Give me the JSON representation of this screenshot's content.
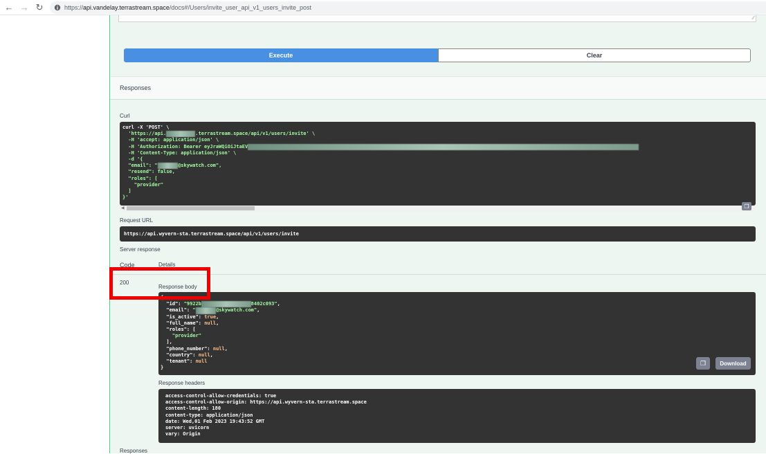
{
  "browser": {
    "url_prefix": "https://",
    "url_host": "api.vandelay.terrastream.space",
    "url_path": "/docs#/Users/invite_user_api_v1_users_invite_post"
  },
  "buttons": {
    "execute": "Execute",
    "clear": "Clear"
  },
  "responses_title": "Responses",
  "curl": {
    "label": "Curl",
    "lines": [
      "curl -X 'POST' \\",
      "  'https://api.",
      ".terrastream.space/api/v1/users/invite' \\",
      "  -H 'accept: application/json' \\",
      "  -H 'Authorization: Bearer eyJraWQiOiJtaEV",
      "  -H 'Content-Type: application/json' \\",
      "  -d '{",
      "  \"email\": \"",
      "@skywatch.com\",",
      "  \"resend\": false,",
      "  \"roles\": [",
      "    \"provider\"",
      "  ]",
      "}'"
    ]
  },
  "request_url": {
    "label": "Request URL",
    "value": "https://api.wyvern-sta.terrastream.space/api/v1/users/invite"
  },
  "server_response": {
    "label": "Server response",
    "code_header": "Code",
    "details_header": "Details",
    "code": "200",
    "body_label": "Response body",
    "download": "Download",
    "body": {
      "id_prefix": "\"9922b",
      "id_suffix": "8402c093\"",
      "email_suffix": "@skywatch.com\"",
      "is_active": "true",
      "full_name": "null",
      "role": "\"provider\"",
      "phone_number": "null",
      "country": "null",
      "tenant": "null"
    },
    "headers_label": "Response headers",
    "headers": [
      "access-control-allow-credentials: true",
      "access-control-allow-origin: https://api.wyvern-sta.terrastream.space",
      "content-length: 180",
      "content-type: application/json",
      "date: Wed,01 Feb 2023 19:43:52 GMT",
      "server: uvicorn",
      "vary: Origin"
    ]
  },
  "bottom_responses_label": "Responses",
  "colors": {
    "execute": "#4990e2",
    "panel_bg": "#edf6f0",
    "highlight": "#ee0000",
    "code_bg": "#333333"
  }
}
